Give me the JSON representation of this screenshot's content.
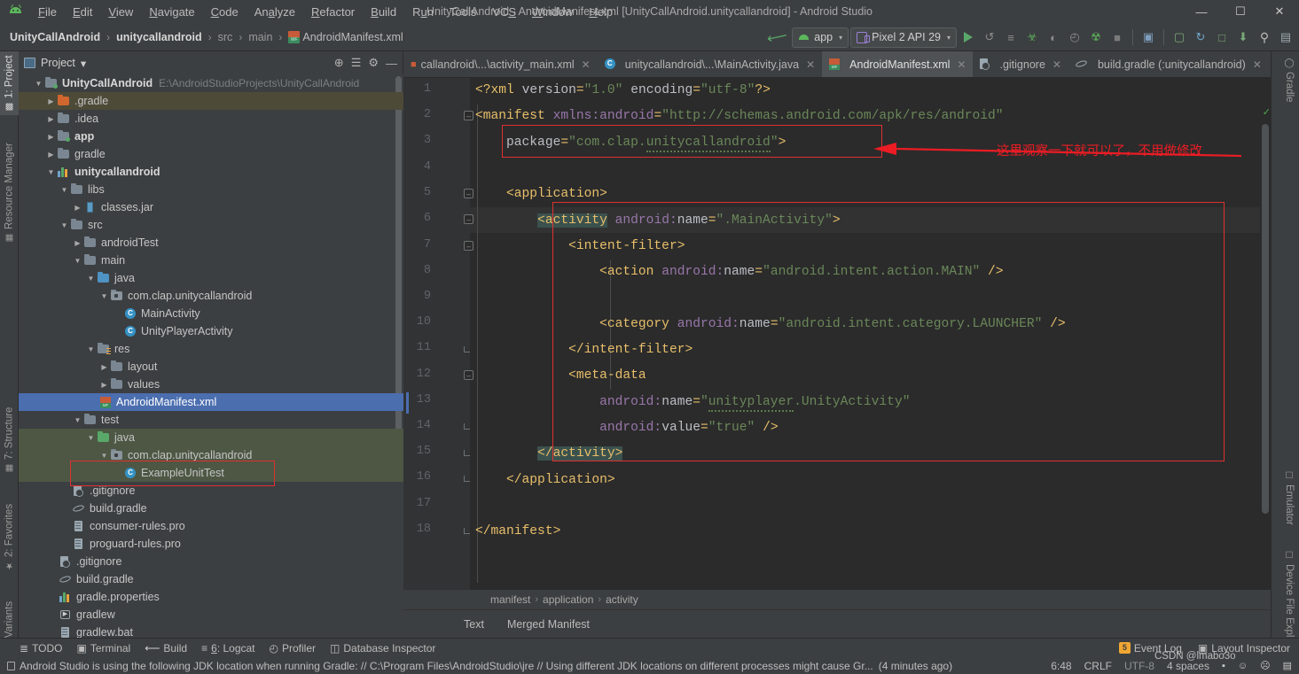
{
  "window": {
    "title": "UnityCallAndroid - AndroidManifest.xml [UnityCallAndroid.unitycallandroid] - Android Studio",
    "minimize": "—",
    "maximize": "☐",
    "close": "✕"
  },
  "menu": [
    "File",
    "Edit",
    "View",
    "Navigate",
    "Code",
    "Analyze",
    "Refactor",
    "Build",
    "Run",
    "Tools",
    "VCS",
    "Window",
    "Help"
  ],
  "breadcrumb": {
    "items": [
      "UnityCallAndroid",
      "unitycallandroid",
      "src",
      "main",
      "AndroidManifest.xml"
    ],
    "separator": "›"
  },
  "toolbar": {
    "module_selector": "app",
    "device_selector": "Pixel 2 API 29",
    "caret": "▾",
    "icons": [
      {
        "name": "run-button",
        "glyph": "▶"
      },
      {
        "name": "apply-changes-icon",
        "glyph": "↺"
      },
      {
        "name": "apply-code-changes-icon",
        "glyph": "≡"
      },
      {
        "name": "debug-icon",
        "glyph": "☠"
      },
      {
        "name": "attach-debugger-icon",
        "glyph": "◐"
      },
      {
        "name": "profiler-icon",
        "glyph": "◴"
      },
      {
        "name": "run-coverage-icon",
        "glyph": "☢"
      },
      {
        "name": "stop-icon",
        "glyph": "■"
      },
      {
        "name": "sdk-manager-icon",
        "glyph": "▣"
      },
      {
        "name": "avd-manager-icon",
        "glyph": "▢"
      },
      {
        "name": "sync-gradle-icon",
        "glyph": "↻"
      },
      {
        "name": "layout-inspector-icon",
        "glyph": "□"
      },
      {
        "name": "device-file-explorer-icon",
        "glyph": "⬇"
      },
      {
        "name": "search-everywhere-icon",
        "glyph": "⌕"
      },
      {
        "name": "account-icon",
        "glyph": "▤"
      }
    ]
  },
  "left_tool_strip": [
    {
      "label": "1: Project",
      "active": true,
      "icon": "project-icon"
    },
    {
      "label": "Resource Manager",
      "active": false,
      "icon": "resource-icon"
    },
    {
      "label": "7: Structure",
      "active": false,
      "icon": "structure-icon"
    },
    {
      "label": "2: Favorites",
      "active": false,
      "icon": "star-icon"
    },
    {
      "label": "Build Variants",
      "active": false,
      "icon": "variants-icon"
    }
  ],
  "right_tool_strip": [
    {
      "label": "Gradle",
      "icon": "gradle-icon"
    },
    {
      "label": "Emulator",
      "icon": "emulator-icon"
    },
    {
      "label": "Device File Explorer",
      "icon": "device-file-explorer-icon"
    }
  ],
  "project_panel": {
    "title": "Project",
    "caret": "▾",
    "actions": [
      {
        "name": "locate-icon",
        "glyph": "⊕"
      },
      {
        "name": "collapse-all-icon",
        "glyph": "☲"
      },
      {
        "name": "settings-gear-icon",
        "glyph": "⚙"
      },
      {
        "name": "hide-panel-icon",
        "glyph": "—"
      }
    ],
    "tree": [
      {
        "label": "UnityCallAndroid",
        "hint": "E:\\AndroidStudioProjects\\UnityCallAndroid",
        "depth": 0,
        "arrow": "▼",
        "icon": "project-root-folder-icon",
        "bold": true,
        "state": "normal"
      },
      {
        "label": ".gradle",
        "hint": "",
        "depth": 1,
        "arrow": "▶",
        "icon": "folder-orange-icon",
        "bold": false,
        "state": "hover"
      },
      {
        "label": ".idea",
        "hint": "",
        "depth": 1,
        "arrow": "▶",
        "icon": "folder-icon",
        "bold": false,
        "state": "normal"
      },
      {
        "label": "app",
        "hint": "",
        "depth": 1,
        "arrow": "▶",
        "icon": "module-folder-icon",
        "bold": true,
        "state": "normal"
      },
      {
        "label": "gradle",
        "hint": "",
        "depth": 1,
        "arrow": "▶",
        "icon": "folder-icon",
        "bold": false,
        "state": "normal"
      },
      {
        "label": "unitycallandroid",
        "hint": "",
        "depth": 1,
        "arrow": "▼",
        "icon": "library-module-icon",
        "bold": true,
        "state": "normal"
      },
      {
        "label": "libs",
        "hint": "",
        "depth": 2,
        "arrow": "▼",
        "icon": "folder-icon",
        "bold": false,
        "state": "normal"
      },
      {
        "label": "classes.jar",
        "hint": "",
        "depth": 3,
        "arrow": "▶",
        "icon": "jar-icon",
        "bold": false,
        "state": "normal"
      },
      {
        "label": "src",
        "hint": "",
        "depth": 2,
        "arrow": "▼",
        "icon": "folder-icon",
        "bold": false,
        "state": "normal"
      },
      {
        "label": "androidTest",
        "hint": "",
        "depth": 3,
        "arrow": "▶",
        "icon": "folder-icon",
        "bold": false,
        "state": "normal"
      },
      {
        "label": "main",
        "hint": "",
        "depth": 3,
        "arrow": "▼",
        "icon": "folder-icon",
        "bold": false,
        "state": "normal"
      },
      {
        "label": "java",
        "hint": "",
        "depth": 4,
        "arrow": "▼",
        "icon": "source-folder-icon",
        "bold": false,
        "state": "normal"
      },
      {
        "label": "com.clap.unitycallandroid",
        "hint": "",
        "depth": 5,
        "arrow": "▼",
        "icon": "package-icon",
        "bold": false,
        "state": "normal"
      },
      {
        "label": "MainActivity",
        "hint": "",
        "depth": 6,
        "arrow": "",
        "icon": "java-class-icon",
        "bold": false,
        "state": "normal"
      },
      {
        "label": "UnityPlayerActivity",
        "hint": "",
        "depth": 6,
        "arrow": "",
        "icon": "java-class-icon",
        "bold": false,
        "state": "normal"
      },
      {
        "label": "res",
        "hint": "",
        "depth": 4,
        "arrow": "▼",
        "icon": "res-folder-icon",
        "bold": false,
        "state": "normal"
      },
      {
        "label": "layout",
        "hint": "",
        "depth": 5,
        "arrow": "▶",
        "icon": "folder-icon",
        "bold": false,
        "state": "normal"
      },
      {
        "label": "values",
        "hint": "",
        "depth": 5,
        "arrow": "▶",
        "icon": "folder-icon",
        "bold": false,
        "state": "normal"
      },
      {
        "label": "AndroidManifest.xml",
        "hint": "",
        "depth": 5,
        "arrow": "",
        "icon": "manifest-icon",
        "bold": false,
        "state": "selected"
      },
      {
        "label": "test",
        "hint": "",
        "depth": 3,
        "arrow": "▼",
        "icon": "folder-icon",
        "bold": false,
        "state": "normal"
      },
      {
        "label": "java",
        "hint": "",
        "depth": 4,
        "arrow": "▼",
        "icon": "test-source-folder-icon",
        "bold": false,
        "state": "green"
      },
      {
        "label": "com.clap.unitycallandroid",
        "hint": "",
        "depth": 5,
        "arrow": "▼",
        "icon": "package-icon",
        "bold": false,
        "state": "green"
      },
      {
        "label": "ExampleUnitTest",
        "hint": "",
        "depth": 6,
        "arrow": "",
        "icon": "java-class-icon",
        "bold": false,
        "state": "green"
      },
      {
        "label": ".gitignore",
        "hint": "",
        "depth": 3,
        "arrow": "",
        "icon": "gitignore-icon",
        "bold": false,
        "state": "normal"
      },
      {
        "label": "build.gradle",
        "hint": "",
        "depth": 3,
        "arrow": "",
        "icon": "gradle-file-icon",
        "bold": false,
        "state": "normal"
      },
      {
        "label": "consumer-rules.pro",
        "hint": "",
        "depth": 3,
        "arrow": "",
        "icon": "text-file-icon",
        "bold": false,
        "state": "normal"
      },
      {
        "label": "proguard-rules.pro",
        "hint": "",
        "depth": 3,
        "arrow": "",
        "icon": "text-file-icon",
        "bold": false,
        "state": "normal"
      },
      {
        "label": ".gitignore",
        "hint": "",
        "depth": 2,
        "arrow": "",
        "icon": "gitignore-icon",
        "bold": false,
        "state": "normal"
      },
      {
        "label": "build.gradle",
        "hint": "",
        "depth": 2,
        "arrow": "",
        "icon": "gradle-file-icon",
        "bold": false,
        "state": "normal"
      },
      {
        "label": "gradle.properties",
        "hint": "",
        "depth": 2,
        "arrow": "",
        "icon": "properties-file-icon",
        "bold": false,
        "state": "normal"
      },
      {
        "label": "gradlew",
        "hint": "",
        "depth": 2,
        "arrow": "",
        "icon": "shell-script-icon",
        "bold": false,
        "state": "normal"
      },
      {
        "label": "gradlew.bat",
        "hint": "",
        "depth": 2,
        "arrow": "",
        "icon": "bat-file-icon",
        "bold": false,
        "state": "normal"
      }
    ]
  },
  "editor_tabs": [
    {
      "label": "callandroid\\...\\activity_main.xml",
      "icon": "xml-file-icon",
      "active": false,
      "close": "✕"
    },
    {
      "label": "unitycallandroid\\...\\MainActivity.java",
      "icon": "java-class-icon",
      "active": false,
      "close": "✕"
    },
    {
      "label": "AndroidManifest.xml",
      "icon": "manifest-icon",
      "active": true,
      "close": "✕"
    },
    {
      "label": ".gitignore",
      "icon": "gitignore-icon",
      "active": false,
      "close": "✕"
    },
    {
      "label": "build.gradle (:unitycallandroid)",
      "icon": "gradle-file-icon",
      "active": false,
      "close": "✕"
    }
  ],
  "editor_tabs_overflow": "⌄",
  "code": {
    "line_numbers": [
      "1",
      "2",
      "3",
      "4",
      "5",
      "6",
      "7",
      "8",
      "9",
      "10",
      "11",
      "12",
      "13",
      "14",
      "15",
      "16",
      "17",
      "18"
    ],
    "lines": [
      "<?xml version=\"1.0\" encoding=\"utf-8\"?>",
      "<manifest xmlns:android=\"http://schemas.android.com/apk/res/android\"",
      "    package=\"com.clap.unitycallandroid\">",
      "",
      "    <application>",
      "        <activity android:name=\".MainActivity\">",
      "            <intent-filter>",
      "                <action android:name=\"android.intent.action.MAIN\" />",
      "",
      "                <category android:name=\"android.intent.category.LAUNCHER\" />",
      "            </intent-filter>",
      "            <meta-data",
      "                android:name=\"unityplayer.UnityActivity\"",
      "                android:value=\"true\" />",
      "        </activity>",
      "    </application>",
      "",
      "</manifest>"
    ]
  },
  "editor_breadcrumbs": {
    "items": [
      "manifest",
      "application",
      "activity"
    ],
    "separator": "›"
  },
  "editor_bottom_tabs": [
    {
      "label": "Text",
      "active": true
    },
    {
      "label": "Merged Manifest",
      "active": false
    }
  ],
  "tool_windows": [
    {
      "label": "TODO",
      "icon": "todo-icon",
      "glyph": "≡"
    },
    {
      "label": "Terminal",
      "icon": "terminal-icon",
      "glyph": "▣"
    },
    {
      "label": "Build",
      "icon": "build-hammer-icon",
      "glyph": "⚒"
    },
    {
      "label": "6: Logcat",
      "icon": "logcat-icon",
      "glyph": "☰",
      "underline_prefix": "6"
    },
    {
      "label": "Profiler",
      "icon": "profiler-icon",
      "glyph": "◴"
    },
    {
      "label": "Database Inspector",
      "icon": "database-icon",
      "glyph": "⌸"
    }
  ],
  "tool_windows_right": [
    {
      "label": "Event Log",
      "icon": "event-log-icon",
      "badge": "5"
    },
    {
      "label": "Layout Inspector",
      "icon": "layout-inspector-icon",
      "badge": ""
    }
  ],
  "status_bar": {
    "message": "Android Studio is using the following JDK location when running Gradle: // C:\\Program Files\\AndroidStudio\\jre // Using different JDK locations on different processes might cause Gr...",
    "time_ago": "(4 minutes ago)",
    "caret_position": "6:48",
    "line_separator": "CRLF",
    "encoding": "UTF-8",
    "indent": "4 spaces",
    "icons": [
      {
        "name": "lock-icon",
        "glyph": "▫"
      },
      {
        "name": "feedback-happy-icon",
        "glyph": "☺"
      },
      {
        "name": "feedback-sad-icon",
        "glyph": "☹"
      },
      {
        "name": "ide-widget-icon",
        "glyph": "☰"
      }
    ]
  },
  "annotations": {
    "note_text": "这里观察一下就可以了，不用做修改",
    "color": "#ec1c24"
  },
  "watermark": "CSDN @lmabo3o",
  "colors": {
    "accent_selection": "#4b6eaf",
    "annotation_red": "#ec1c24",
    "editor_bg": "#2b2b2b",
    "panel_bg": "#3c3f41",
    "tag_yellow": "#e8bf6a",
    "attr_purple": "#9876aa",
    "string_green": "#6a8759"
  }
}
